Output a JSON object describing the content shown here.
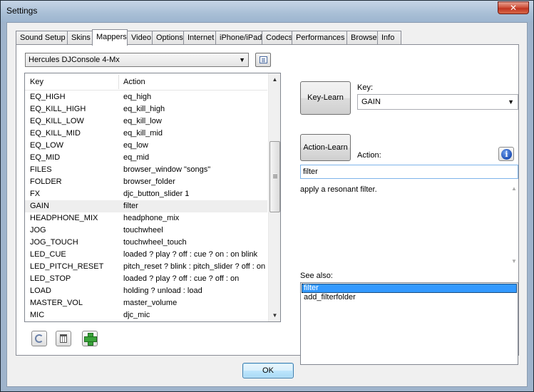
{
  "window": {
    "title": "Settings",
    "close_glyph": "✕"
  },
  "tabs": [
    {
      "label": "Sound Setup",
      "active": false
    },
    {
      "label": "Skins",
      "active": false
    },
    {
      "label": "Mappers",
      "active": true
    },
    {
      "label": "Video",
      "active": false
    },
    {
      "label": "Options",
      "active": false
    },
    {
      "label": "Internet",
      "active": false
    },
    {
      "label": "iPhone/iPad",
      "active": false
    },
    {
      "label": "Codecs",
      "active": false
    },
    {
      "label": "Performances",
      "active": false
    },
    {
      "label": "Browser",
      "active": false
    },
    {
      "label": "Info",
      "active": false
    }
  ],
  "mapper": {
    "device_combo": {
      "value": "Hercules DJConsole 4-Mx",
      "arrow": "▼"
    },
    "list_icon": "list-view-icon",
    "columns": {
      "key": "Key",
      "action": "Action"
    },
    "rows": [
      {
        "key": "EQ_HIGH",
        "action": "eq_high"
      },
      {
        "key": "EQ_KILL_HIGH",
        "action": "eq_kill_high"
      },
      {
        "key": "EQ_KILL_LOW",
        "action": "eq_kill_low"
      },
      {
        "key": "EQ_KILL_MID",
        "action": "eq_kill_mid"
      },
      {
        "key": "EQ_LOW",
        "action": "eq_low"
      },
      {
        "key": "EQ_MID",
        "action": "eq_mid"
      },
      {
        "key": "FILES",
        "action": "browser_window \"songs\""
      },
      {
        "key": "FOLDER",
        "action": "browser_folder"
      },
      {
        "key": "FX",
        "action": "djc_button_slider 1"
      },
      {
        "key": "GAIN",
        "action": "filter",
        "selected": true
      },
      {
        "key": "HEADPHONE_MIX",
        "action": "headphone_mix"
      },
      {
        "key": "JOG",
        "action": "touchwheel"
      },
      {
        "key": "JOG_TOUCH",
        "action": "touchwheel_touch"
      },
      {
        "key": "LED_CUE",
        "action": "loaded ? play ? off : cue ? on : on blink"
      },
      {
        "key": "LED_PITCH_RESET",
        "action": "pitch_reset ? blink : pitch_slider ? off : on"
      },
      {
        "key": "LED_STOP",
        "action": "loaded ? play ? off : cue ? off : on"
      },
      {
        "key": "LOAD",
        "action": "holding ? unload : load"
      },
      {
        "key": "MASTER_VOL",
        "action": "master_volume"
      },
      {
        "key": "MIC",
        "action": "djc_mic"
      }
    ],
    "scroll_up": "▲",
    "scroll_down": "▼",
    "scroll_position": 0.36
  },
  "bottom_buttons": [
    "reload-icon",
    "trash-icon",
    "add-icon"
  ],
  "right": {
    "key_learn_label": "Key-Learn",
    "key_label": "Key:",
    "key_value": "GAIN",
    "key_arrow": "▼",
    "action_learn_label": "Action-Learn",
    "action_label": "Action:",
    "info_glyph": "i",
    "action_value": "filter",
    "description": "apply a resonant filter.",
    "desc_up": "▲",
    "desc_down": "▼",
    "see_also_label": "See also:",
    "see_also": [
      {
        "label": "filter",
        "selected": true
      },
      {
        "label": "add_filterfolder",
        "selected": false
      }
    ]
  },
  "footer": {
    "ok_label": "OK"
  }
}
